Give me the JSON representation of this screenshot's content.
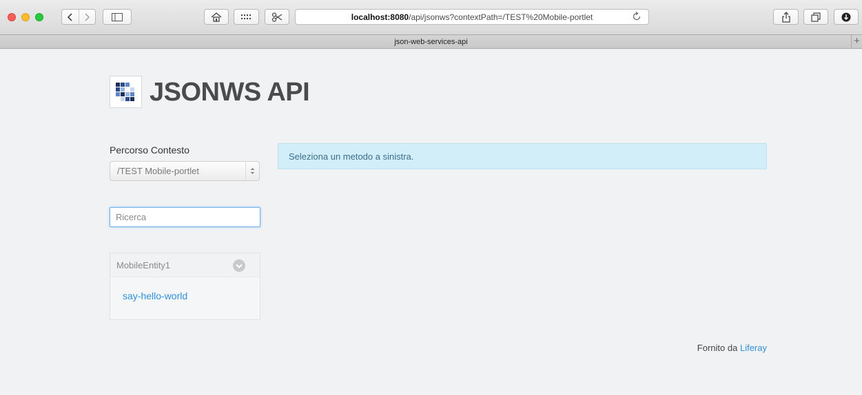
{
  "browser": {
    "url_host": "localhost:8080",
    "url_path": "/api/jsonws?contextPath=/TEST%20Mobile-portlet",
    "tab_title": "json-web-services-api",
    "new_tab_glyph": "+"
  },
  "header": {
    "title": "JSONWS API"
  },
  "sidebar": {
    "context_label": "Percorso Contesto",
    "context_value": "/TEST Mobile-portlet",
    "search_placeholder": "Ricerca",
    "entities": [
      {
        "name": "MobileEntity1",
        "methods": [
          "say-hello-world"
        ]
      }
    ]
  },
  "main": {
    "info_message": "Seleziona un metodo a sinistra."
  },
  "footer": {
    "prefix": "Fornito da",
    "link_text": "Liferay"
  },
  "colors": {
    "link": "#2f8fd8",
    "alert_bg": "#d2eef8",
    "page_bg": "#f1f2f4"
  }
}
